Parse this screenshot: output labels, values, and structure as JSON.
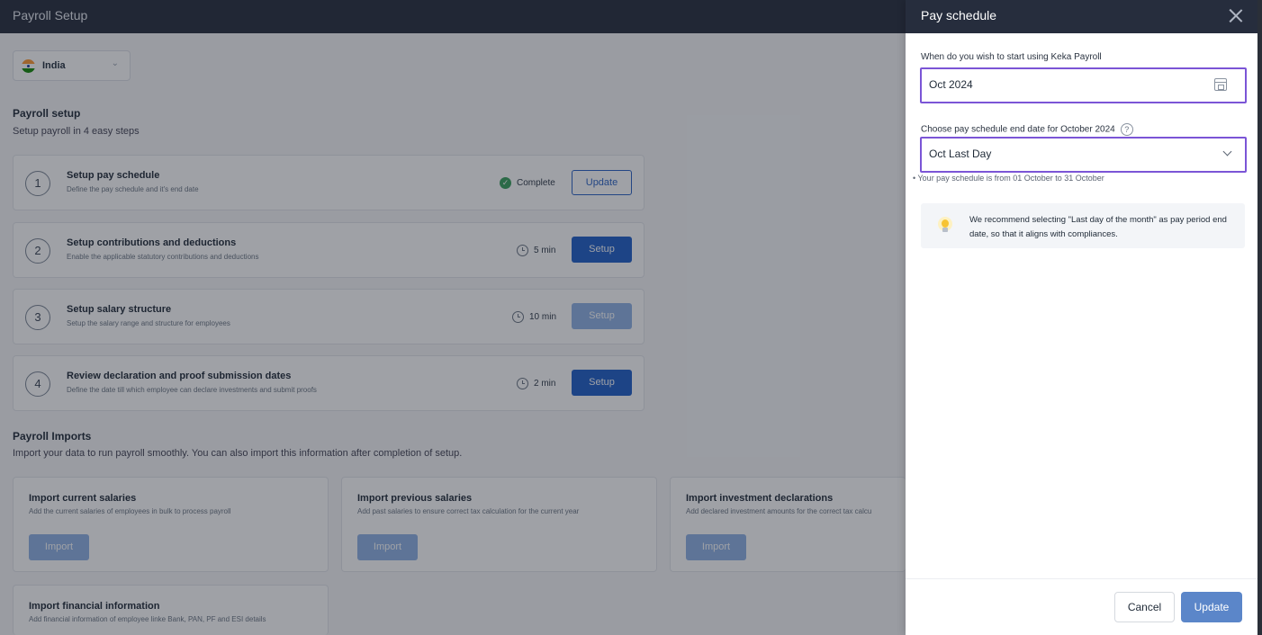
{
  "app_title": "Payroll Setup",
  "country": {
    "label": "India"
  },
  "setup": {
    "title": "Payroll setup",
    "subtitle": "Setup payroll in 4 easy steps",
    "steps": [
      {
        "num": "1",
        "title": "Setup pay schedule",
        "desc": "Define the pay schedule and it's end date",
        "status": "Complete",
        "action": "Update"
      },
      {
        "num": "2",
        "title": "Setup contributions and deductions",
        "desc": "Enable the applicable statutory contributions and deductions",
        "status": "5 min",
        "action": "Setup"
      },
      {
        "num": "3",
        "title": "Setup salary structure",
        "desc": "Setup the salary range and structure for employees",
        "status": "10 min",
        "action": "Setup"
      },
      {
        "num": "4",
        "title": "Review declaration and proof submission dates",
        "desc": "Define the date till which employee can declare investments and submit proofs",
        "status": "2 min",
        "action": "Setup"
      }
    ]
  },
  "imports": {
    "title": "Payroll Imports",
    "subtitle": "Import your data to run payroll smoothly. You can also import this information after completion of setup.",
    "cards": [
      {
        "title": "Import current salaries",
        "desc": "Add the current salaries of employees in bulk to process payroll",
        "button": "Import"
      },
      {
        "title": "Import previous salaries",
        "desc": "Add past salaries to ensure correct tax calculation for the current year",
        "button": "Import"
      },
      {
        "title": "Import investment declarations",
        "desc": "Add declared investment amounts for the correct tax calcu",
        "button": "Import"
      },
      {
        "title": "Import financial information",
        "desc": "Add financial information of employee linke Bank, PAN, PF and ESI details"
      }
    ]
  },
  "panel": {
    "title": "Pay schedule",
    "start_label": "When do you wish to start using Keka Payroll",
    "start_value": "Oct 2024",
    "end_label": "Choose pay schedule end date for October 2024",
    "end_value": "Oct Last Day",
    "hint": "Your pay schedule is from 01 October to 31 October",
    "tip": "We recommend selecting \"Last day of the month\" as pay period end date, so that it aligns with compliances.",
    "cancel_label": "Cancel",
    "update_label": "Update"
  },
  "colors": {
    "header": "#262d3d",
    "primary": "#1f5fc8",
    "highlight": "#7b55d6",
    "success": "#3aa05d"
  },
  "icons": [
    "flag-india-icon",
    "chevron-down-icon",
    "check-circle-icon",
    "clock-icon",
    "close-icon",
    "calendar-icon",
    "help-icon",
    "bulb-icon"
  ]
}
